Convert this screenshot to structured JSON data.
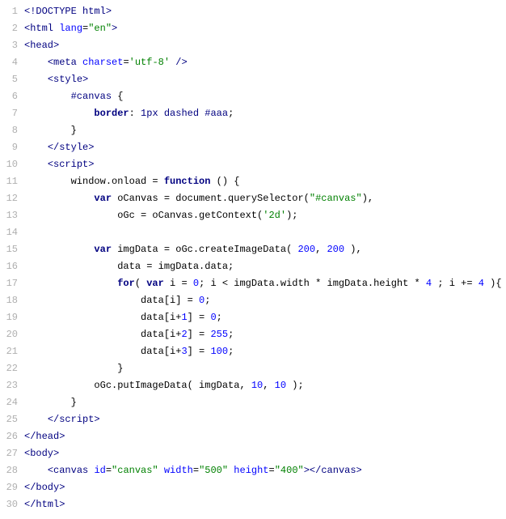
{
  "lines": [
    {
      "n": "1",
      "html": "<span class='tag'>&lt;!DOCTYPE html&gt;</span>"
    },
    {
      "n": "2",
      "html": "<span class='tag'>&lt;html</span> <span class='attr-name'>lang</span>=<span class='attr-value'>\"en\"</span><span class='tag'>&gt;</span>"
    },
    {
      "n": "3",
      "html": "<span class='tag'>&lt;head&gt;</span>"
    },
    {
      "n": "4",
      "html": "    <span class='tag'>&lt;meta</span> <span class='attr-name'>charset</span>=<span class='attr-value'>'utf-8'</span> <span class='tag'>/&gt;</span>"
    },
    {
      "n": "5",
      "html": "    <span class='tag'>&lt;style&gt;</span>"
    },
    {
      "n": "6",
      "html": "        <span class='sel'>#canvas</span> {"
    },
    {
      "n": "7",
      "html": "            <span class='prop'>border</span>: <span class='val'>1px dashed #aaa</span>;"
    },
    {
      "n": "8",
      "html": "        }"
    },
    {
      "n": "9",
      "html": "    <span class='tag'>&lt;/style&gt;</span>"
    },
    {
      "n": "10",
      "html": "    <span class='tag'>&lt;script&gt;</span>"
    },
    {
      "n": "11",
      "html": "        window.onload = <span class='kw'>function</span> () {"
    },
    {
      "n": "12",
      "html": "            <span class='kw'>var</span> oCanvas = document.querySelector(<span class='string'>\"#canvas\"</span>),"
    },
    {
      "n": "13",
      "html": "                oGc = oCanvas.getContext(<span class='string'>'2d'</span>);"
    },
    {
      "n": "14",
      "html": ""
    },
    {
      "n": "15",
      "html": "            <span class='kw'>var</span> imgData = oGc.createImageData( <span class='num'>200</span>, <span class='num'>200</span> ),"
    },
    {
      "n": "16",
      "html": "                data = imgData.data;"
    },
    {
      "n": "17",
      "html": "                <span class='kw'>for</span>( <span class='kw'>var</span> i = <span class='num'>0</span>; i &lt; imgData.width * imgData.height * <span class='num'>4</span> ; i += <span class='num'>4</span> ){"
    },
    {
      "n": "18",
      "html": "                    data[i] = <span class='num'>0</span>;"
    },
    {
      "n": "19",
      "html": "                    data[i+<span class='num'>1</span>] = <span class='num'>0</span>;"
    },
    {
      "n": "20",
      "html": "                    data[i+<span class='num'>2</span>] = <span class='num'>255</span>;"
    },
    {
      "n": "21",
      "html": "                    data[i+<span class='num'>3</span>] = <span class='num'>100</span>;"
    },
    {
      "n": "22",
      "html": "                }"
    },
    {
      "n": "23",
      "html": "            oGc.putImageData( imgData, <span class='num'>10</span>, <span class='num'>10</span> );"
    },
    {
      "n": "24",
      "html": "        }"
    },
    {
      "n": "25",
      "html": "    <span class='tag'>&lt;/script&gt;</span>"
    },
    {
      "n": "26",
      "html": "<span class='tag'>&lt;/head&gt;</span>"
    },
    {
      "n": "27",
      "html": "<span class='tag'>&lt;body&gt;</span>"
    },
    {
      "n": "28",
      "html": "    <span class='tag'>&lt;canvas</span> <span class='attr-name'>id</span>=<span class='attr-value'>\"canvas\"</span> <span class='attr-name'>width</span>=<span class='attr-value'>\"500\"</span> <span class='attr-name'>height</span>=<span class='attr-value'>\"400\"</span><span class='tag'>&gt;&lt;/canvas&gt;</span>"
    },
    {
      "n": "29",
      "html": "<span class='tag'>&lt;/body&gt;</span>"
    },
    {
      "n": "30",
      "html": "<span class='tag'>&lt;/html&gt;</span>"
    }
  ]
}
